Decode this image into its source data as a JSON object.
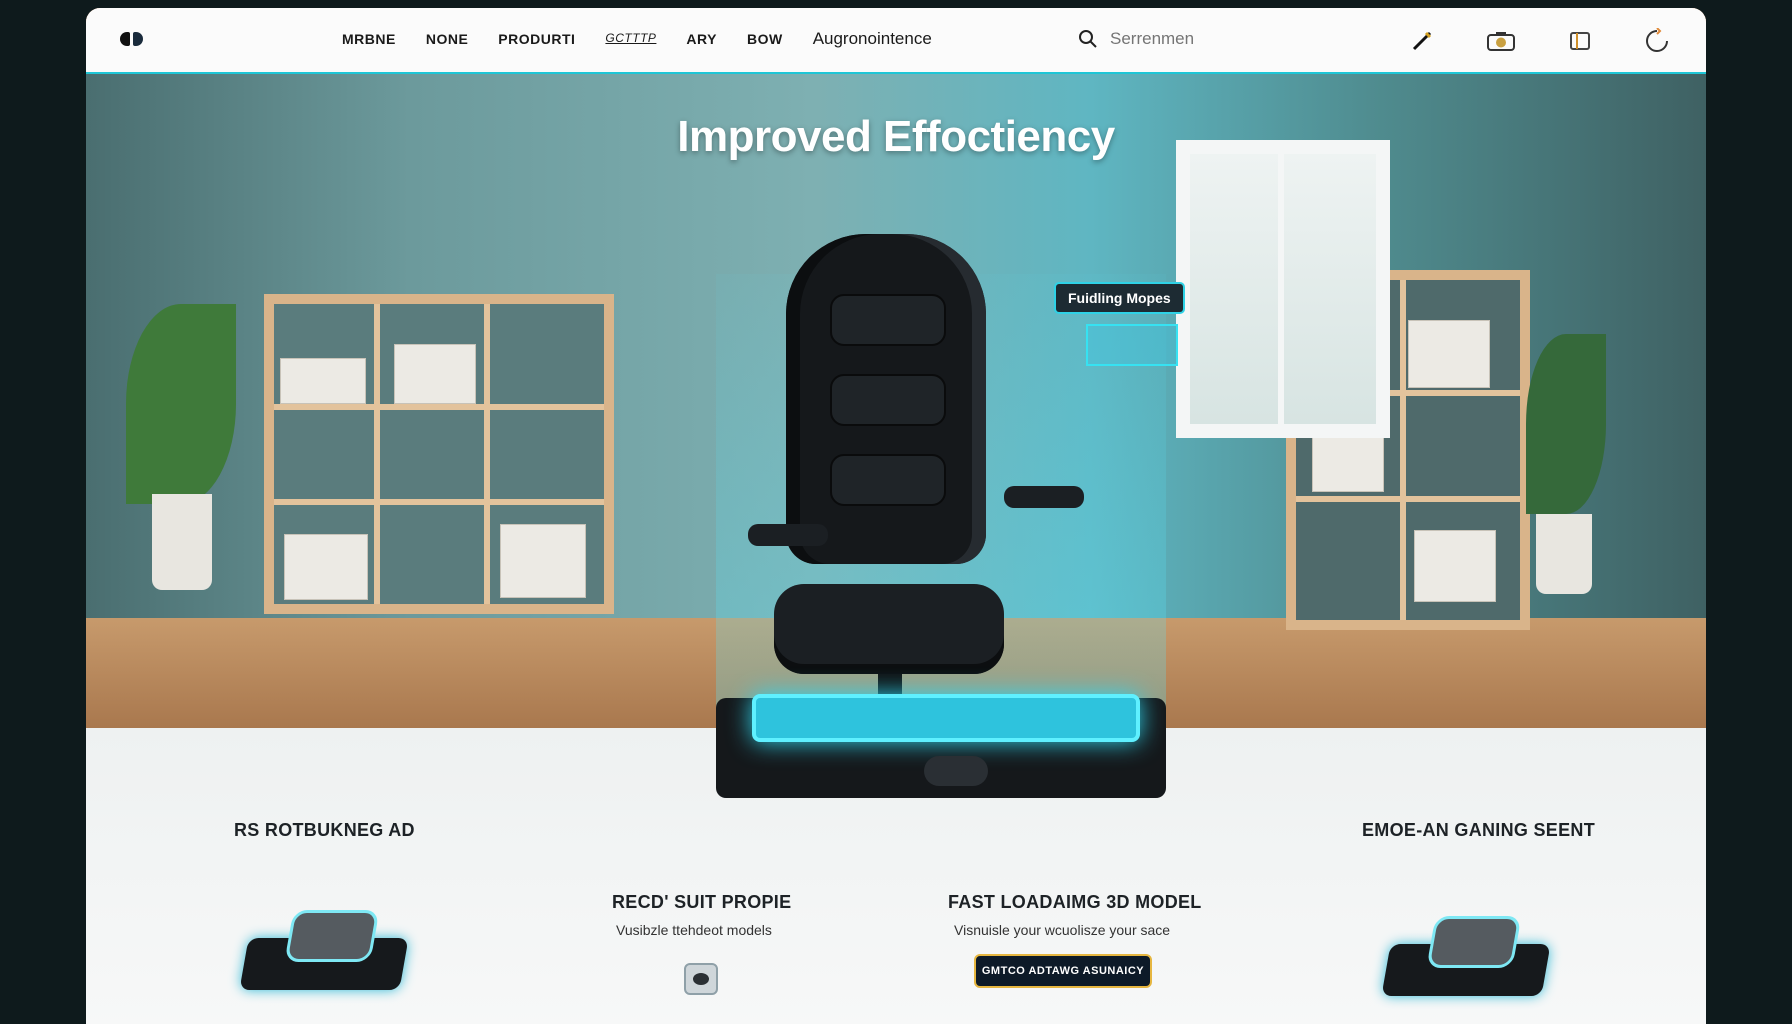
{
  "nav": {
    "items": [
      "MRBNE",
      "NONE",
      "PRODURTI",
      "GCTTTP",
      "ARY",
      "BOW",
      "Augronointence"
    ],
    "search_placeholder": "Serrenmen"
  },
  "hero": {
    "title": "Improved Effoctiency",
    "tag_label": "Fuidling Mopes"
  },
  "features": {
    "left_heading": "RS ROTBUKNEG AD",
    "center_left_heading": "RECD' SUIT PROPIE",
    "center_left_sub": "Vusibzle ttehdeot models",
    "center_right_heading": "FAST LOADAIMG  3D MODEL",
    "center_right_sub": "Visnuisle your wcuolisze your sace",
    "cta_label": "GMTCO ADTAWG ASUNAICY",
    "right_heading": "EMOE-AN GANING SEENT"
  },
  "colors": {
    "accent": "#2ec3dd",
    "cta_border": "#e6b640",
    "frame_edge": "#e07a3a"
  },
  "icons": {
    "logo": "logo-mark",
    "search": "search-icon",
    "pen": "pen-icon",
    "camera": "camera-icon",
    "panel": "panel-icon",
    "refresh": "refresh-icon"
  }
}
